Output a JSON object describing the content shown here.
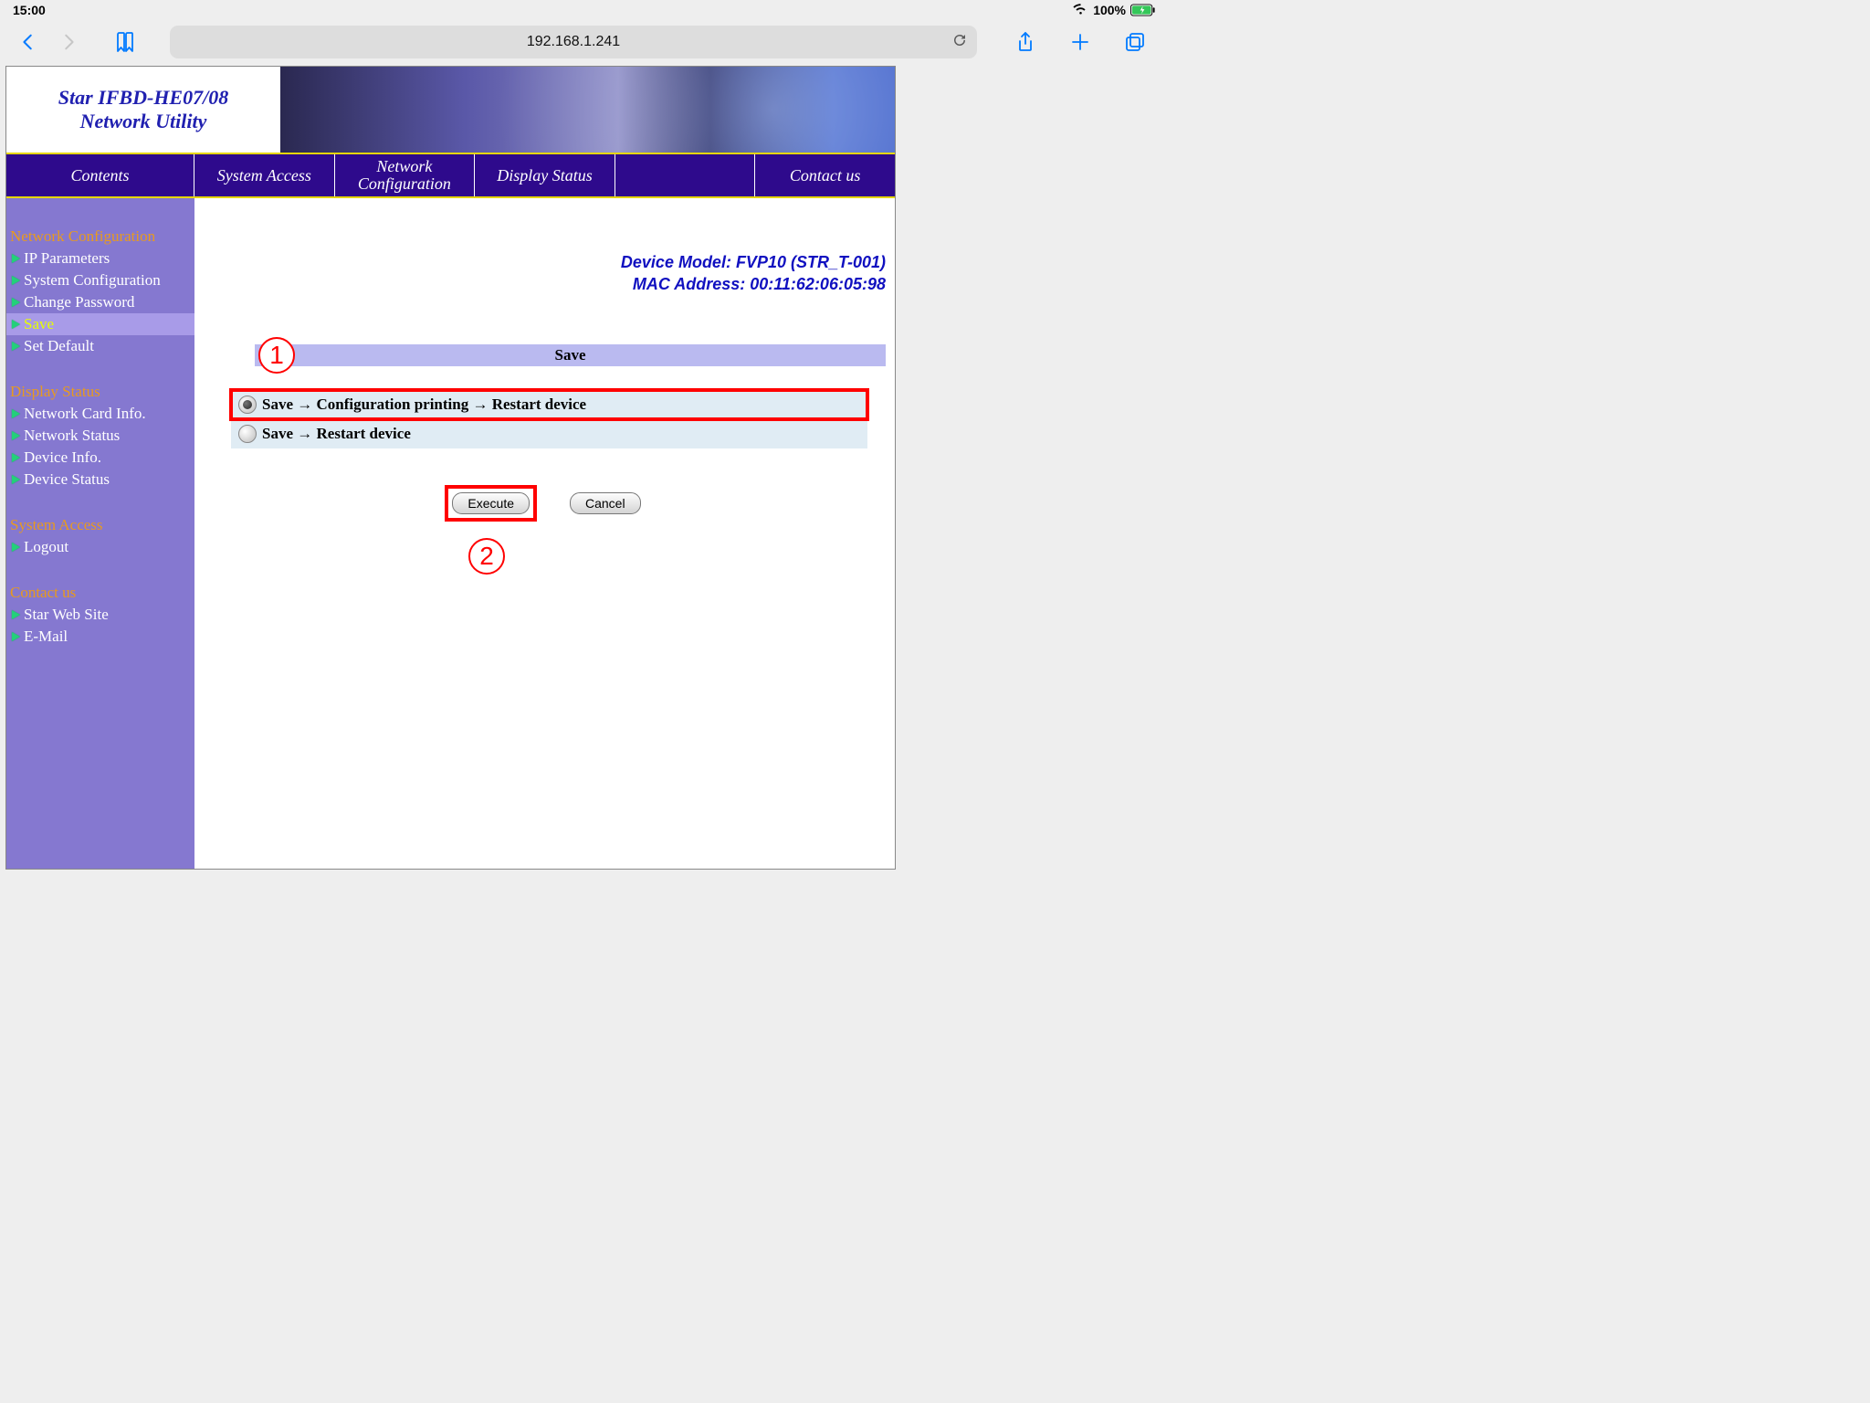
{
  "status": {
    "time": "15:00",
    "battery": "100%"
  },
  "toolbar": {
    "url": "192.168.1.241"
  },
  "banner": {
    "line1": "Star IFBD-HE07/08",
    "line2": "Network Utility"
  },
  "topnav": {
    "contents": "Contents",
    "system_access": "System Access",
    "network_config": "Network Configuration",
    "display_status": "Display Status",
    "blank": "",
    "contact": "Contact us"
  },
  "sidebar": {
    "netconf": {
      "title": "Network Configuration",
      "ip": "IP Parameters",
      "sysconf": "System Configuration",
      "chpass": "Change Password",
      "save": "Save",
      "setdef": "Set Default"
    },
    "status": {
      "title": "Display Status",
      "nci": "Network Card Info.",
      "ns": "Network Status",
      "di": "Device Info.",
      "ds": "Device Status"
    },
    "sysacc": {
      "title": "System Access",
      "logout": "Logout"
    },
    "contact": {
      "title": "Contact us",
      "web": "Star Web Site",
      "email": "E-Mail"
    }
  },
  "content": {
    "model_label": "Device Model: FVP10 (STR_T-001)",
    "mac_label": "MAC Address: 00:11:62:06:05:98",
    "section_title": "Save",
    "option1": "Save → Configuration printing → Restart device",
    "option2": "Save → Restart device",
    "execute": "Execute",
    "cancel": "Cancel",
    "call1": "1",
    "call2": "2"
  }
}
